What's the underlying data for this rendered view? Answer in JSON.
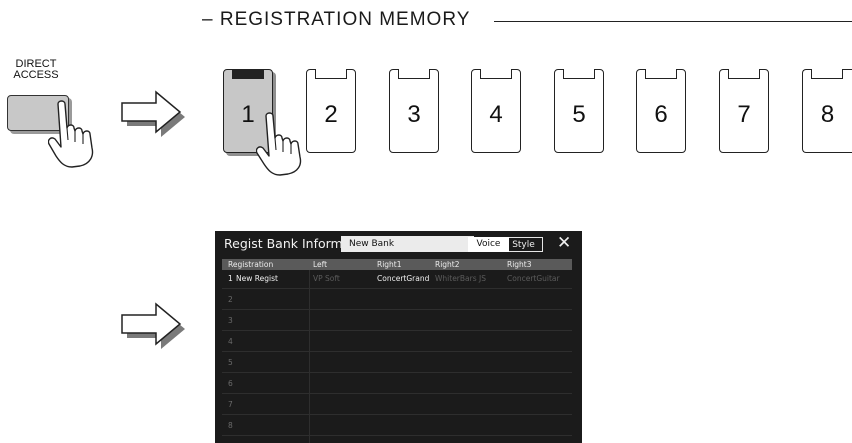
{
  "section": {
    "title": "– REGISTRATION MEMORY"
  },
  "direct_access": {
    "line1": "DIRECT",
    "line2": "ACCESS"
  },
  "memory_buttons": [
    "1",
    "2",
    "3",
    "4",
    "5",
    "6",
    "7",
    "8"
  ],
  "active_button": "1",
  "colors": {
    "button_active_fill": "#c7c7c7",
    "panel_bg": "#1b1b1b",
    "header_bg": "#5a5a5a"
  },
  "icons": [
    "hand-pointer-icon",
    "right-arrow-icon",
    "close-icon"
  ],
  "dialog": {
    "title": "Regist Bank Information",
    "bank_name": "New Bank",
    "voice_label": "Voice",
    "style_label": "Style",
    "close_label": "✕",
    "columns": [
      "Registration",
      "Left",
      "Right1",
      "Right2",
      "Right3"
    ],
    "rows": [
      {
        "num": "1",
        "name": "New Regist",
        "left": "VP Soft",
        "right1": "ConcertGrand",
        "right2": "WhiterBars JS",
        "right3": "ConcertGuitar"
      },
      {
        "num": "2"
      },
      {
        "num": "3"
      },
      {
        "num": "4"
      },
      {
        "num": "5"
      },
      {
        "num": "6"
      },
      {
        "num": "7"
      },
      {
        "num": "8"
      }
    ]
  }
}
